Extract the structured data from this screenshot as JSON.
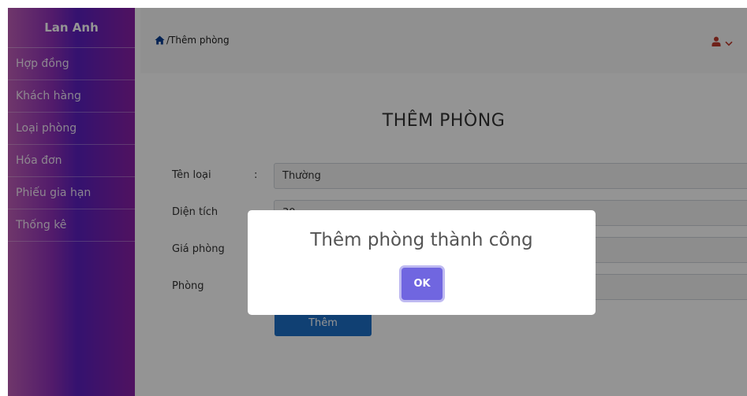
{
  "sidebar": {
    "brand": "Lan Anh",
    "items": [
      {
        "label": "Hợp đồng"
      },
      {
        "label": "Khách hàng"
      },
      {
        "label": "Loại phòng"
      },
      {
        "label": "Hóa đơn"
      },
      {
        "label": "Phiếu gia hạn"
      },
      {
        "label": "Thống kê"
      }
    ]
  },
  "header": {
    "breadcrumb": "/Thêm phòng",
    "icons": {
      "home": "home-icon",
      "user": "user-icon",
      "chevron": "chevron-down-icon"
    }
  },
  "form": {
    "title": "THÊM PHÒNG",
    "colon": ":",
    "fields": [
      {
        "label": "Tên loại",
        "value": "Thường"
      },
      {
        "label": "Diện tích",
        "value": "30"
      },
      {
        "label": "Giá phòng",
        "value": ""
      },
      {
        "label": "Phòng",
        "value": ""
      }
    ],
    "submit_label": "Thêm"
  },
  "dialog": {
    "title": "Thêm phòng thành công",
    "ok_label": "OK"
  },
  "colors": {
    "header_icon": "#c0392b",
    "home_icon": "#0a3d91",
    "submit": "#1d6fc6",
    "ok": "#7066e0"
  }
}
